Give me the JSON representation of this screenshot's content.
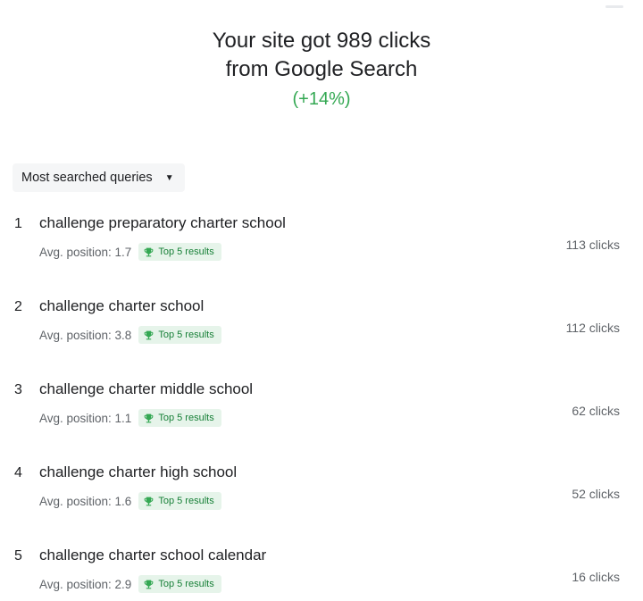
{
  "summary": {
    "line1": "Your site got 989 clicks",
    "line2": "from Google Search",
    "change": "(+14%)"
  },
  "filter": {
    "label": "Most searched queries"
  },
  "icons": {
    "badge_icon": "trophy-icon",
    "dropdown_icon": "caret-down-icon"
  },
  "colors": {
    "positive": "#34a853",
    "badge_bg": "#e6f4ea",
    "badge_text": "#188038"
  },
  "queries": [
    {
      "rank": "1",
      "text": "challenge preparatory charter school",
      "position": "Avg. position: 1.7",
      "badge": "Top 5 results",
      "clicks": "113 clicks"
    },
    {
      "rank": "2",
      "text": "challenge charter school",
      "position": "Avg. position: 3.8",
      "badge": "Top 5 results",
      "clicks": "112 clicks"
    },
    {
      "rank": "3",
      "text": "challenge charter middle school",
      "position": "Avg. position: 1.1",
      "badge": "Top 5 results",
      "clicks": "62 clicks"
    },
    {
      "rank": "4",
      "text": "challenge charter high school",
      "position": "Avg. position: 1.6",
      "badge": "Top 5 results",
      "clicks": "52 clicks"
    },
    {
      "rank": "5",
      "text": "challenge charter school calendar",
      "position": "Avg. position: 2.9",
      "badge": "Top 5 results",
      "clicks": "16 clicks"
    }
  ]
}
